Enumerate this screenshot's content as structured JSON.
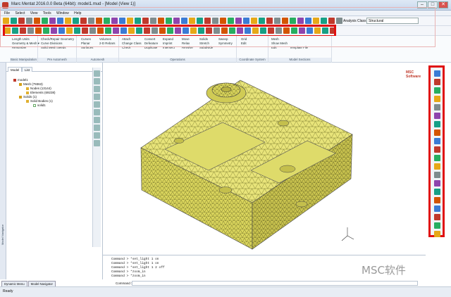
{
  "window": {
    "title": "Marc Mentat 2016.0.0 Beta (64bit): model1.mud - [Model (View 1)]",
    "min": "–",
    "max": "□",
    "close": "✕"
  },
  "menu": [
    "File",
    "Select",
    "View",
    "Tools",
    "Window",
    "Help"
  ],
  "analysis": {
    "label": "Analysis Class",
    "value": "Structural"
  },
  "ribbon": {
    "groups": [
      {
        "label": "Basic Manipulation",
        "items": [
          "Geometry & Mesh ▾",
          "Renumber"
        ],
        "header": "Length Units"
      },
      {
        "label": "Pre Automesh",
        "items": [
          "Check/Repair Geometry",
          "Curve Divisions",
          "Solid Mesh Seeds"
        ]
      },
      {
        "label": "Automesh",
        "items": [
          "Curves",
          "Planar",
          "Surfaces",
          "Volumes",
          "2-D Rebars"
        ]
      },
      {
        "label": "Operations",
        "items": [
          "Attach",
          "Change Class",
          "Check",
          "Convert",
          "Defeature",
          "Duplicate",
          "Expand",
          "Imprint",
          "Intersect",
          "Move",
          "Relax",
          "Revolve",
          "Solids",
          "Stretch",
          "Subdivide",
          "Sweep",
          "Symmetry"
        ]
      },
      {
        "label": "Coordinate System",
        "items": [
          "Grid",
          "Edit"
        ]
      },
      {
        "label": "Model Sections",
        "items": [
          "Mesh",
          "Show Mesh",
          "Edit",
          "Template File"
        ]
      }
    ]
  },
  "panel": {
    "tabs": [
      "Model",
      "List"
    ],
    "tree": [
      {
        "text": "model1",
        "level": 0
      },
      {
        "text": "Mesh (79363)",
        "level": 1
      },
      {
        "text": "Nodes (13144)",
        "level": 2
      },
      {
        "text": "Elements (69238)",
        "level": 2
      },
      {
        "text": "Solids (1)",
        "level": 1
      },
      {
        "text": "Solid Bodies (1)",
        "level": 2
      },
      {
        "text": "solid1",
        "level": 3
      }
    ],
    "bottom_tabs": [
      "Dynamic Menu",
      "Model Navigator"
    ],
    "strip_label": "Model Navigator"
  },
  "logo": "MSC Software",
  "command": {
    "lines": [
      "Command > *set_light 1 on",
      "Command > *set_light 1 on",
      "Command > *set_light 1 2 off",
      "Command > *zoom_in",
      "Command > *zoom_in"
    ],
    "label": "Command >"
  },
  "status": "Ready",
  "watermark": "MSC软件",
  "colors": {
    "red_box": "#e01010",
    "mesh": "#e8e47a",
    "mesh_line": "#5a5a1f"
  }
}
